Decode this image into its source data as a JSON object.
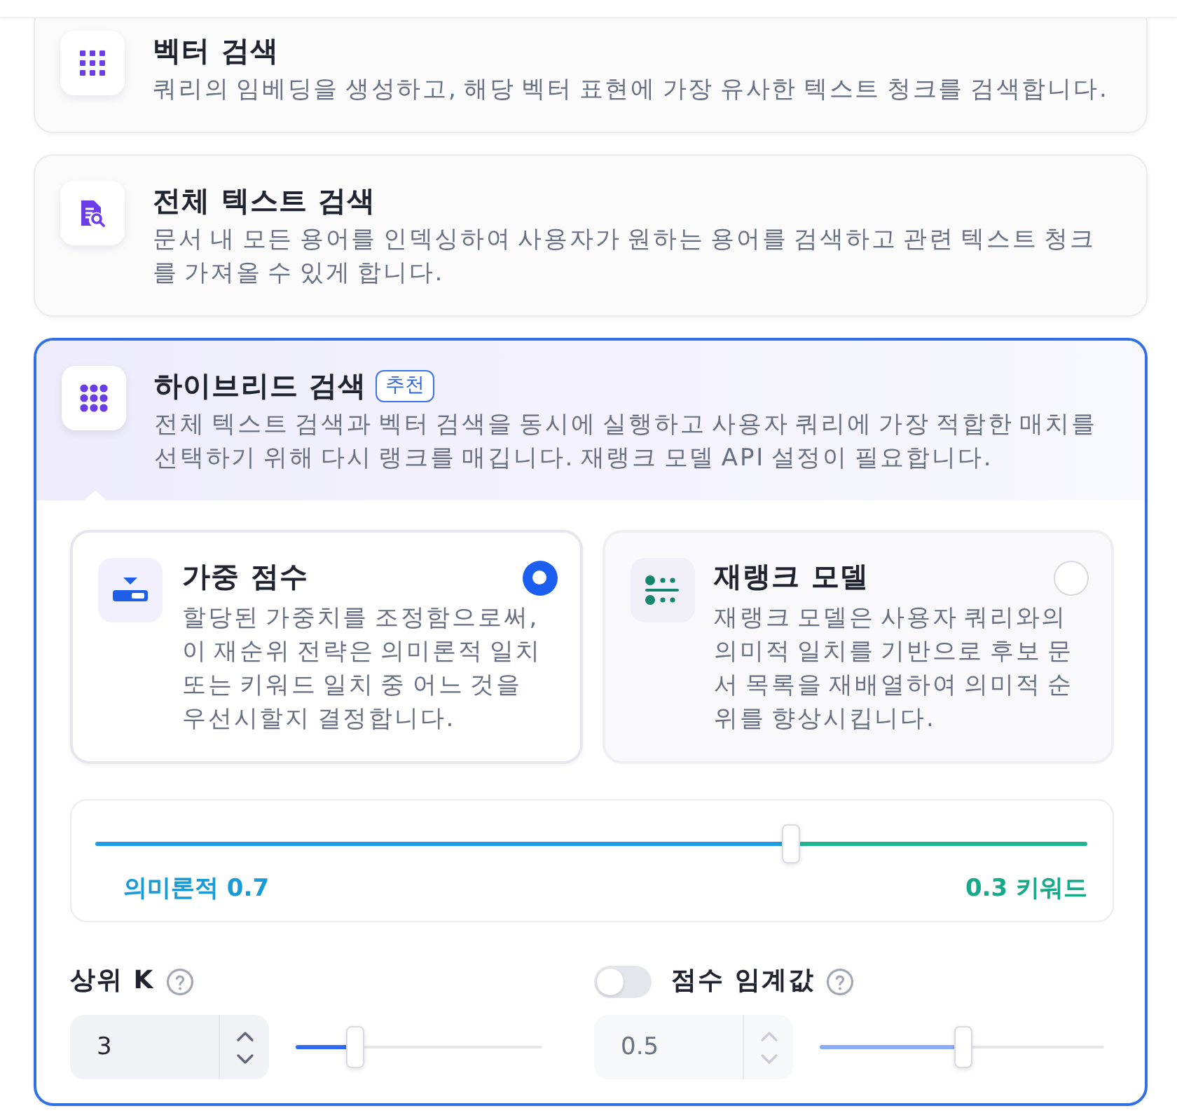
{
  "methods": [
    {
      "kind": "vector",
      "title": "벡터 검색",
      "description": "쿼리의 임베딩을 생성하고, 해당 벡터 표현에 가장 유사한 텍스트 청크를 검색합니다.",
      "selected": false
    },
    {
      "kind": "full_text",
      "title": "전체 텍스트 검색",
      "description": "문서 내 모든 용어를 인덱싱하여 사용자가 원하는 용어를 검색하고 관련 텍스트 청크를 가져올 수 있게 합니다.",
      "selected": false
    },
    {
      "kind": "hybrid",
      "title": "하이브리드 검색",
      "badge": "추천",
      "description": "전체 텍스트 검색과 벡터 검색을 동시에 실행하고 사용자 쿼리에 가장 적합한 매치를 선택하기 위해 다시 랭크를 매깁니다. 재랭크 모델 API 설정이 필요합니다.",
      "selected": true,
      "settings": {
        "options": [
          {
            "kind": "weighted",
            "title": "가중 점수",
            "description": "할당된 가중치를 조정함으로써, 이 재순위 전략은 의미론적 일치 또는 키워드 일치 중 어느 것을 우선시할지 결정합니다.",
            "selected": true
          },
          {
            "kind": "rerank",
            "title": "재랭크 모델",
            "description": "재랭크 모델은 사용자 쿼리와의 의미적 일치를 기반으로 후보 문서 목록을 재배열하여 의미적 순위를 향상시킵니다.",
            "selected": false
          }
        ],
        "weight": {
          "semantic_label": "의미론적 0.7",
          "keyword_label": "0.3 키워드",
          "level": 0.7
        },
        "top_k": {
          "label": "상위 K",
          "value": "3",
          "level": 0.24
        },
        "score_threshold": {
          "label": "점수 임계값",
          "on": false,
          "value": "0.5",
          "level": 0.5
        }
      }
    }
  ]
}
